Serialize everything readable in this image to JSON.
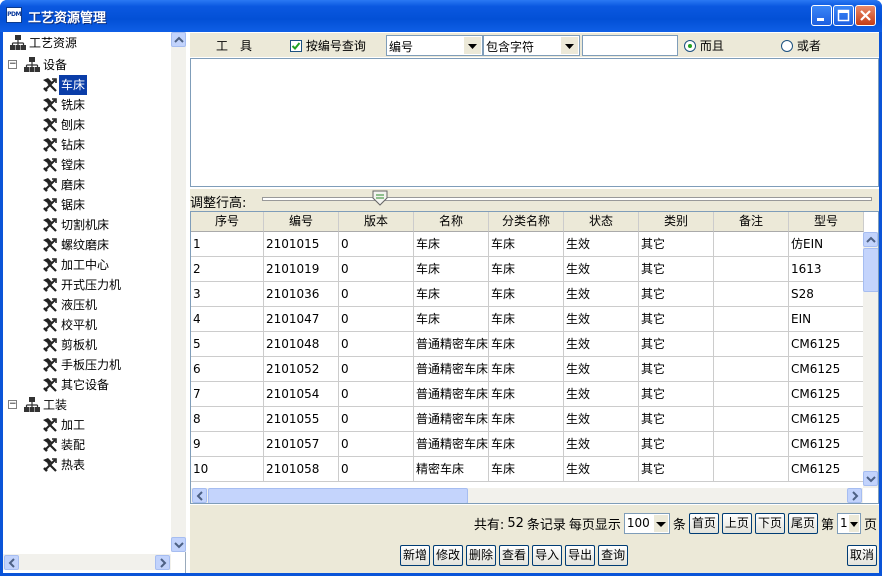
{
  "window": {
    "title": "工艺资源管理",
    "icon_text": "PDM",
    "colors": {
      "titlebar": "#0a54d8",
      "selection": "#0a3da8",
      "panel": "#ece9d8"
    }
  },
  "tree": {
    "root": "工艺资源",
    "groups": [
      {
        "label": "设备",
        "expanded": true,
        "items": [
          "车床",
          "铣床",
          "刨床",
          "钻床",
          "镗床",
          "磨床",
          "锯床",
          "切割机床",
          "螺纹磨床",
          "加工中心",
          "开式压力机",
          "液压机",
          "校平机",
          "剪板机",
          "手板压力机",
          "其它设备"
        ]
      },
      {
        "label": "工装",
        "expanded": true,
        "items": [
          "加工",
          "装配",
          "热表"
        ]
      }
    ],
    "selected": "车床"
  },
  "toolbar": {
    "tools_label": "工　具",
    "by_code_label": "按编号查询",
    "by_code_checked": true,
    "field_value": "编号",
    "match_value": "包含字符",
    "search_value": "",
    "and_label": "而且",
    "or_label": "或者",
    "selected_logic": "and"
  },
  "row_height": {
    "label": "调整行高:",
    "level": 0.2
  },
  "table": {
    "columns": [
      "序号",
      "编号",
      "版本",
      "名称",
      "分类名称",
      "状态",
      "类别",
      "备注",
      "型号"
    ],
    "rows": [
      [
        "1",
        "2101015",
        "0",
        "车床",
        "车床",
        "生效",
        "其它",
        "",
        "仿EIN"
      ],
      [
        "2",
        "2101019",
        "0",
        "车床",
        "车床",
        "生效",
        "其它",
        "",
        "1613"
      ],
      [
        "3",
        "2101036",
        "0",
        "车床",
        "车床",
        "生效",
        "其它",
        "",
        "S28"
      ],
      [
        "4",
        "2101047",
        "0",
        "车床",
        "车床",
        "生效",
        "其它",
        "",
        "EIN"
      ],
      [
        "5",
        "2101048",
        "0",
        "普通精密车床",
        "车床",
        "生效",
        "其它",
        "",
        "CM6125"
      ],
      [
        "6",
        "2101052",
        "0",
        "普通精密车床",
        "车床",
        "生效",
        "其它",
        "",
        "CM6125"
      ],
      [
        "7",
        "2101054",
        "0",
        "普通精密车床",
        "车床",
        "生效",
        "其它",
        "",
        "CM6125"
      ],
      [
        "8",
        "2101055",
        "0",
        "普通精密车床",
        "车床",
        "生效",
        "其它",
        "",
        "CM6125"
      ],
      [
        "9",
        "2101057",
        "0",
        "普通精密车床",
        "车床",
        "生效",
        "其它",
        "",
        "CM6125"
      ],
      [
        "10",
        "2101058",
        "0",
        "精密车床",
        "车床",
        "生效",
        "其它",
        "",
        "CM6125"
      ]
    ]
  },
  "paging": {
    "total_prefix": "共有:",
    "total": "52",
    "total_suffix": "条记录",
    "per_page_label": "每页显示",
    "per_page": "100",
    "per_page_unit": "条",
    "first": "首页",
    "prev": "上页",
    "next": "下页",
    "last": "尾页",
    "page_prefix": "第",
    "page": "1",
    "page_suffix": "页"
  },
  "actions": {
    "add": "新增",
    "edit": "修改",
    "delete": "删除",
    "view": "查看",
    "import": "导入",
    "export": "导出",
    "query": "查询",
    "cancel": "取消"
  }
}
